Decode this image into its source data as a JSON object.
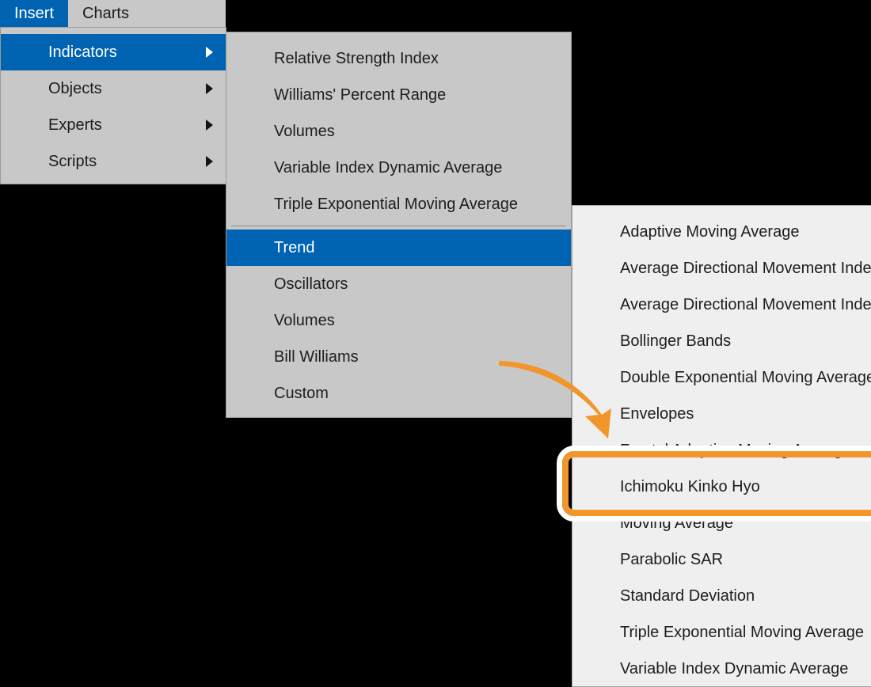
{
  "menubar": {
    "items": [
      {
        "label": "Insert",
        "active": true
      },
      {
        "label": "Charts",
        "active": false
      }
    ]
  },
  "panel_insert": {
    "items": [
      {
        "label": "Indicators",
        "selected": true,
        "submenu": true
      },
      {
        "label": "Objects",
        "selected": false,
        "submenu": true
      },
      {
        "label": "Experts",
        "selected": false,
        "submenu": true
      },
      {
        "label": "Scripts",
        "selected": false,
        "submenu": true
      }
    ]
  },
  "panel_indicators": {
    "items": [
      {
        "label": "Relative Strength Index",
        "selected": false,
        "submenu": false,
        "separator_after": false
      },
      {
        "label": "Williams' Percent Range",
        "selected": false,
        "submenu": false,
        "separator_after": false
      },
      {
        "label": "Volumes",
        "selected": false,
        "submenu": false,
        "separator_after": false
      },
      {
        "label": "Variable Index Dynamic Average",
        "selected": false,
        "submenu": false,
        "separator_after": false
      },
      {
        "label": "Triple Exponential Moving Average",
        "selected": false,
        "submenu": false,
        "separator_after": true
      },
      {
        "label": "Trend",
        "selected": true,
        "submenu": false,
        "separator_after": false
      },
      {
        "label": "Oscillators",
        "selected": false,
        "submenu": false,
        "separator_after": false
      },
      {
        "label": "Volumes",
        "selected": false,
        "submenu": false,
        "separator_after": false
      },
      {
        "label": "Bill Williams",
        "selected": false,
        "submenu": false,
        "separator_after": false
      },
      {
        "label": "Custom",
        "selected": false,
        "submenu": false,
        "separator_after": false
      }
    ]
  },
  "panel_trend": {
    "items": [
      {
        "label": "Adaptive Moving Average"
      },
      {
        "label": "Average Directional Movement Index"
      },
      {
        "label": "Average Directional Movement Index Wilder"
      },
      {
        "label": "Bollinger Bands"
      },
      {
        "label": "Double Exponential Moving Average"
      },
      {
        "label": "Envelopes"
      },
      {
        "label": "Fractal Adaptive Moving Average"
      },
      {
        "label": "Ichimoku Kinko Hyo"
      },
      {
        "label": "Moving Average"
      },
      {
        "label": "Parabolic SAR"
      },
      {
        "label": "Standard Deviation"
      },
      {
        "label": "Triple Exponential Moving Average"
      },
      {
        "label": "Variable Index Dynamic Average"
      }
    ],
    "highlighted_item": "Ichimoku Kinko Hyo"
  },
  "annotation": {
    "arrow_name": "curved-pointer-arrow",
    "callout_target": "Ichimoku Kinko Hyo"
  },
  "colors": {
    "menu_background": "#c8c8c8",
    "submenu_background": "#efefef",
    "selection_blue": "#0063b1",
    "highlight_orange": "#f0962a",
    "text": "#1d1d1d",
    "desktop": "#000000"
  }
}
